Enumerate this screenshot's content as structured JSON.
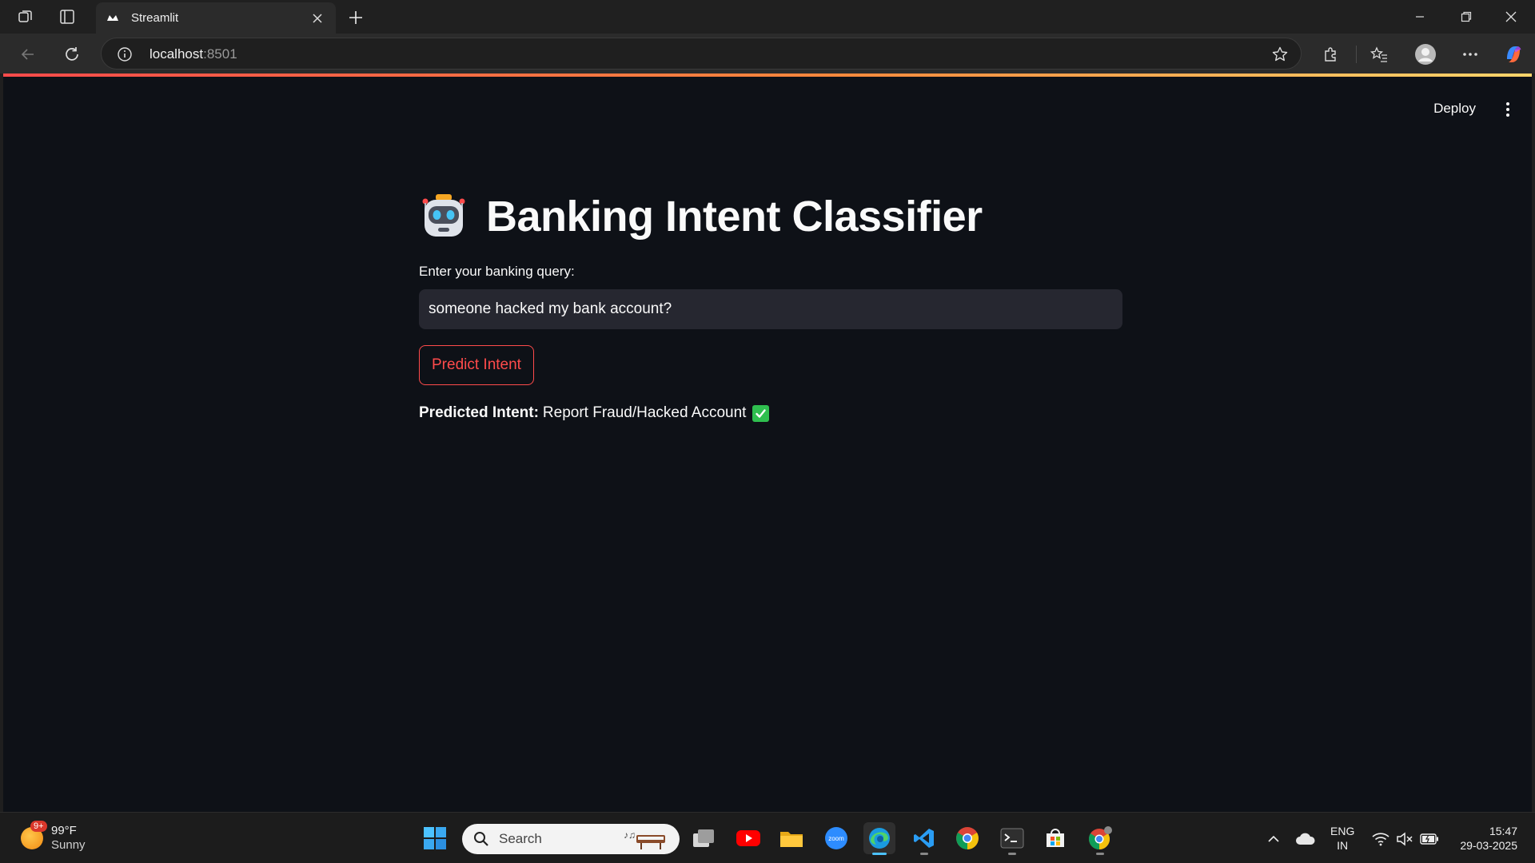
{
  "browser": {
    "tab_title": "Streamlit",
    "url_host": "localhost",
    "url_port": ":8501"
  },
  "app": {
    "deploy_label": "Deploy",
    "title": "Banking Intent Classifier",
    "title_icon": "robot-face",
    "input_label": "Enter your banking query:",
    "input_value": "someone hacked my bank account?",
    "button_label": "Predict Intent",
    "result_label": "Predicted Intent:",
    "result_value": "Report Fraud/Hacked Account",
    "result_icon": "check-mark-button",
    "accent_color": "#ff4b4b",
    "background_color": "#0e1117"
  },
  "taskbar": {
    "weather_badge": "9+",
    "weather_temp": "99°F",
    "weather_condition": "Sunny",
    "search_label": "Search",
    "apps": [
      "task-view",
      "youtube",
      "file-explorer",
      "zoom",
      "edge",
      "vscode",
      "chrome",
      "terminal",
      "microsoft-store",
      "chrome-profile"
    ],
    "lang_line1": "ENG",
    "lang_line2": "IN",
    "time": "15:47",
    "date": "29-03-2025"
  }
}
